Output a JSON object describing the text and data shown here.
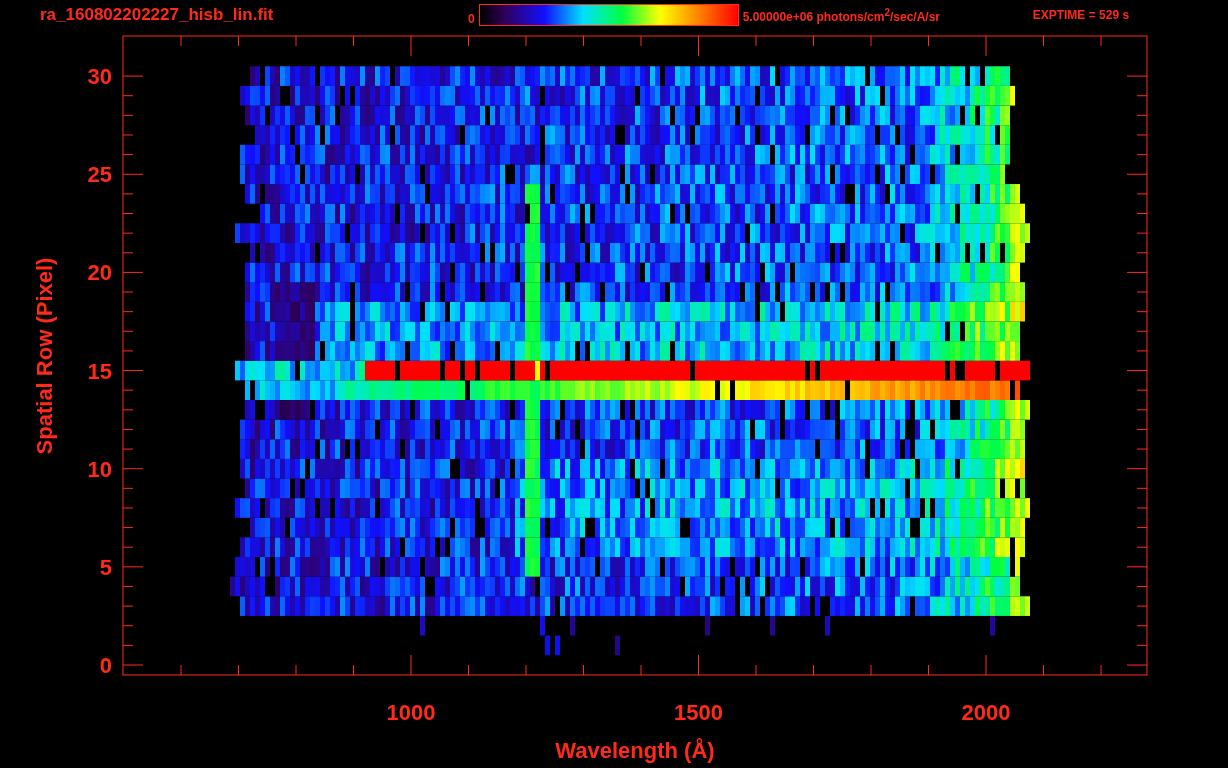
{
  "title": "ra_160802202227_hisb_lin.fit",
  "colorbar": {
    "min_label": "0",
    "max_label": "5.00000e+06 photons/cm$^{2}$/sec/A/sr"
  },
  "exposure": "EXPTIME = 529 s",
  "plot": {
    "ylabel": "Spatial Row (Pixel)",
    "xlabel": "Wavelength (Å)",
    "yticks": [
      "30",
      "25",
      "20",
      "15",
      "10",
      "5",
      "0"
    ],
    "xticks": [
      "1000",
      "1500",
      "2000"
    ]
  }
}
